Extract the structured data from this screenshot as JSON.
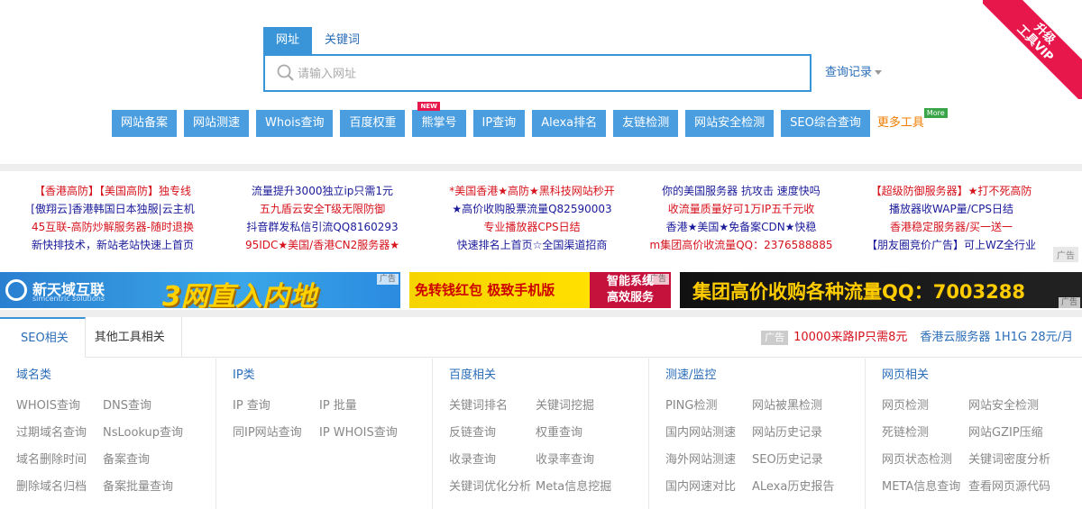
{
  "ribbon": {
    "line1": "升级",
    "line2": "工具VIP"
  },
  "search": {
    "tabs": [
      "网址",
      "关键词"
    ],
    "placeholder": "请输入网址",
    "history_label": "查询记录"
  },
  "tools": {
    "buttons": [
      "网站备案",
      "网站测速",
      "Whois查询",
      "百度权重",
      "熊掌号",
      "IP查询",
      "Alexa排名",
      "友链检测",
      "网站安全检测",
      "SEO综合查询"
    ],
    "new_badge": "NEW",
    "more_label": "更多工具",
    "more_badge": "More"
  },
  "text_ads": {
    "col1": [
      "【香港高防】【美国高防】独专线",
      "[傲翔云]香港韩国日本独服|云主机",
      "45互联-高防炒解服务器-随时退换",
      "新快排技术，新站老站快速上首页"
    ],
    "col2": [
      "流量提升3000独立ip只需1元",
      "五九盾云安全T级无限防御",
      "抖音群发私信引流QQ8160293",
      "95IDC★美国/香港CN2服务器★"
    ],
    "col3": [
      "*美国香港★高防★黑科技网站秒开",
      "★高价收购股票流量Q82590003",
      "专业播放器CPS日结",
      "快速排名上首页☆全国渠道招商"
    ],
    "col4": [
      "你的美国服务器 抗攻击 速度快吗",
      "收流量质量好可1万IP五千元收",
      "香港★美国★免备案CDN★快稳",
      "m集团高价收流量QQ：2376588885"
    ],
    "col5": [
      "【超级防御服务器】★打不死高防",
      "播放器收WAP量/CPS日结",
      "香港稳定服务器/买一送一",
      "【朋友圈竞价广告】可上WZ全行业"
    ],
    "tag": "广告"
  },
  "banners": {
    "b1": {
      "brand": "新天域互联",
      "brand_sub": "simcentric solutions",
      "slogan": "3网直入内地",
      "tag": "广告"
    },
    "b2": {
      "left": "免转钱红包 极致手机版",
      "right1": "智能系统",
      "right2": "高效服务",
      "tag": "广告"
    },
    "b3": {
      "text": "集团高价收购各种流量QQ：7003288",
      "tag": "广告"
    }
  },
  "lower": {
    "tabs": [
      "SEO相关",
      "其他工具相关"
    ],
    "promo_tag": "广告",
    "promo_red": "10000来路IP只需8元",
    "promo_blue": "香港云服务器 1H1G 28元/月"
  },
  "groups": [
    {
      "title": "域名类",
      "items": [
        "WHOIS查询",
        "DNS查询",
        "过期域名查询",
        "NsLookup查询",
        "域名删除时间",
        "备案查询",
        "删除域名归档",
        "备案批量查询"
      ]
    },
    {
      "title": "IP类",
      "items": [
        "IP 查询",
        "IP 批量",
        "同IP网站查询",
        "IP WHOIS查询"
      ]
    },
    {
      "title": "百度相关",
      "items": [
        "关键词排名",
        "关键词挖掘",
        "反链查询",
        "权重查询",
        "收录查询",
        "收录率查询",
        "关键词优化分析",
        "Meta信息挖掘"
      ]
    },
    {
      "title": "测速/监控",
      "items": [
        "PING检测",
        "网站被黑检测",
        "国内网站测速",
        "网站历史记录",
        "海外网站测速",
        "SEO历史记录",
        "国内网速对比",
        "ALexa历史报告"
      ]
    },
    {
      "title": "网页相关",
      "items": [
        "网页检测",
        "网站安全检测",
        "死链检测",
        "网站GZIP压缩",
        "网页状态检测",
        "关键词密度分析",
        "META信息查询",
        "查看网页源代码"
      ]
    }
  ]
}
